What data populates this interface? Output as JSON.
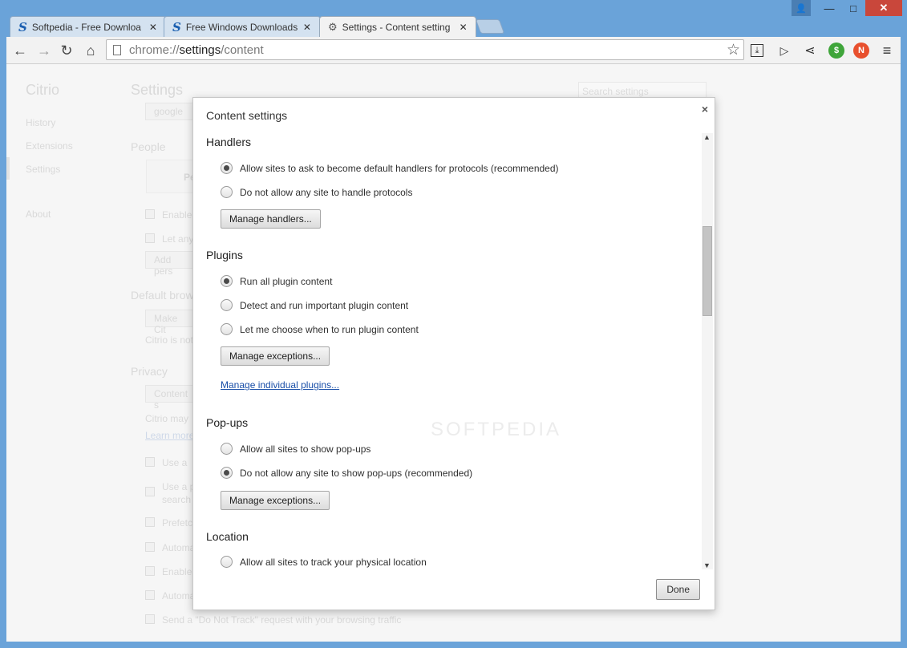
{
  "tabs": [
    {
      "title": "Softpedia - Free Downloa",
      "icon": "softpedia-icon"
    },
    {
      "title": "Free Windows Downloads",
      "icon": "softpedia-icon"
    },
    {
      "title": "Settings - Content setting",
      "icon": "gear-icon",
      "active": true
    }
  ],
  "window_controls": {
    "user": "👤",
    "minimize": "—",
    "maximize": "□",
    "close": "✕"
  },
  "toolbar": {
    "back": "←",
    "forward": "→",
    "reload": "↻",
    "home": "⌂",
    "url_scheme": "chrome://",
    "url_host": "settings",
    "url_path": "/content",
    "star": "☆",
    "download": "⤓",
    "play": "▷",
    "share": "⋖",
    "dollar": "$",
    "n_badge": "N",
    "menu": "≡"
  },
  "background": {
    "app_name": "Citrio",
    "sidebar": [
      "History",
      "Extensions",
      "Settings",
      "About"
    ],
    "settings_title": "Settings",
    "search_placeholder": "Search settings",
    "google_field": "google",
    "people_heading": "People",
    "people_partial": "Pe",
    "enable_partial": "Enable",
    "letany_partial": "Let any",
    "add_person_partial": "Add pers",
    "default_browser_heading": "Default brow",
    "make_citrio_partial": "Make Cit",
    "citrio_is_not_partial": "Citrio is not",
    "privacy_heading": "Privacy",
    "content_settings_partial": "Content s",
    "citrio_may_partial": "Citrio may",
    "learn_more_partial": "Learn more",
    "use_a_partial": "Use a",
    "use_a2_partial": "Use a p",
    "search_partial": "search",
    "prefetch_partial": "Prefetc",
    "automat_partial": "Automa",
    "enable2_partial": "Enable",
    "automat2_partial": "Automa",
    "do_not_track": "Send a \"Do Not Track\" request with your browsing traffic"
  },
  "dialog": {
    "title": "Content settings",
    "close": "×",
    "handlers": {
      "heading": "Handlers",
      "options": [
        "Allow sites to ask to become default handlers for protocols (recommended)",
        "Do not allow any site to handle protocols"
      ],
      "button": "Manage handlers..."
    },
    "plugins": {
      "heading": "Plugins",
      "options": [
        "Run all plugin content",
        "Detect and run important plugin content",
        "Let me choose when to run plugin content"
      ],
      "button": "Manage exceptions...",
      "link": "Manage individual plugins..."
    },
    "popups": {
      "heading": "Pop-ups",
      "options": [
        "Allow all sites to show pop-ups",
        "Do not allow any site to show pop-ups (recommended)"
      ],
      "button": "Manage exceptions..."
    },
    "location": {
      "heading": "Location",
      "options": [
        "Allow all sites to track your physical location"
      ]
    },
    "done": "Done",
    "watermark": "SOFTPEDIA"
  }
}
